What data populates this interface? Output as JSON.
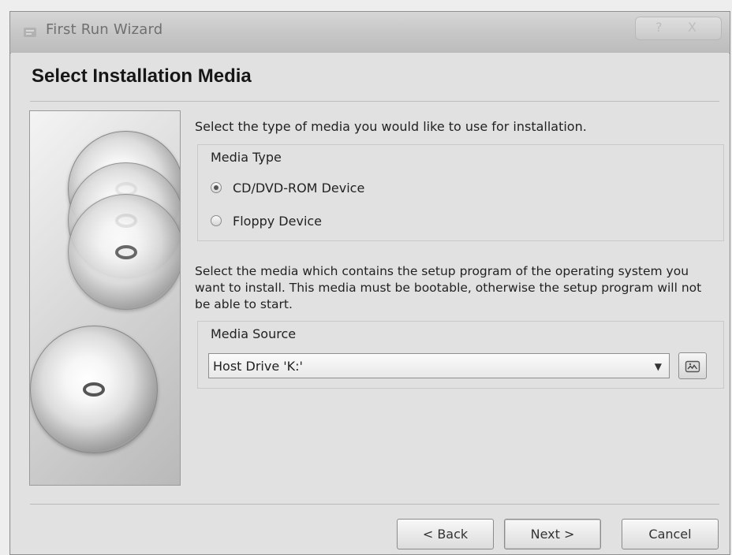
{
  "window": {
    "title": "First Run Wizard",
    "help_label": "?",
    "close_label": "X",
    "icons": {
      "app": "wizard-icon",
      "browse": "folder-browse-icon"
    }
  },
  "page": {
    "title": "Select Installation Media",
    "intro": "Select the type of media you would like to use for installation.",
    "media_type": {
      "label": "Media Type",
      "options": [
        {
          "label": "CD/DVD-ROM Device",
          "selected": true
        },
        {
          "label": "Floppy Device",
          "selected": false
        }
      ]
    },
    "description": "Select the media which contains the setup program of the operating system you want to install. This media must be bootable, otherwise the setup program will not be able to start.",
    "media_source": {
      "label": "Media Source",
      "selected_value": "Host Drive 'K:'"
    }
  },
  "buttons": {
    "back": "< Back",
    "next": "Next >",
    "cancel": "Cancel"
  }
}
